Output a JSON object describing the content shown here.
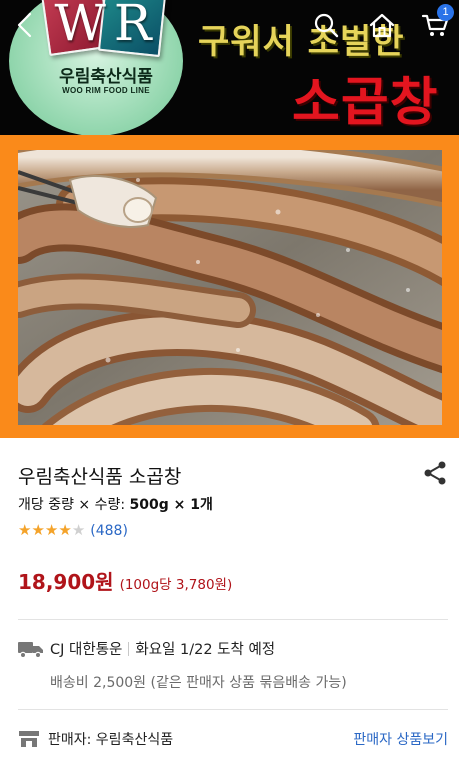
{
  "hero": {
    "logo_letters": "WR",
    "logo_korean": "우림축산식품",
    "logo_english": "WOO RIM FOOD LINE",
    "tagline": "구워서 초벌한",
    "headline": "소곱창"
  },
  "nav": {
    "back_icon": "chevron-left-icon",
    "search_icon": "search-icon",
    "home_icon": "home-icon",
    "cart_icon": "cart-icon",
    "cart_count": "1"
  },
  "product": {
    "title": "우림축산식품 소곱창",
    "spec_prefix": "개당 중량 × 수량: ",
    "spec_value": "500g × 1개",
    "rating": 4,
    "rating_max": 5,
    "review_count": "(488)",
    "price": "18,900원",
    "unit_price": "(100g당 3,780원)"
  },
  "delivery": {
    "carrier": "CJ 대한통운",
    "arrival": "화요일 1/22 도착 예정",
    "fee_note": "배송비 2,500원 (같은 판매자 상품 묶음배송 가능)"
  },
  "seller": {
    "label": "판매자: 우림축산식품",
    "link": "판매자 상품보기"
  },
  "colors": {
    "price_red": "#b0141a",
    "link_blue": "#2b68c5",
    "star_orange": "#f4a32a",
    "frame_orange": "#fa8a1a",
    "badge_blue": "#2a73e8"
  }
}
